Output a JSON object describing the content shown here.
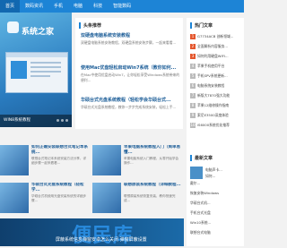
{
  "nav": {
    "items": [
      "首页",
      "数码资讯",
      "手机",
      "电脑",
      "科技",
      "智能数码"
    ]
  },
  "hero": {
    "logo_text": "系统之家",
    "caption": "WIN8系统教程"
  },
  "headlines": {
    "label": "头条推荐",
    "items": [
      {
        "title": "双硬盘电脑系统安装教程",
        "desc": "双硬盘电脑系统安装教程，双硬盘系统安装步骤，一起来看看..."
      },
      {
        "title": "使用Mac优盘轻松启动Win7系统（教你如何...",
        "desc": "在Mac中使用优盘启动Win7，让你轻松享受Windows系统带来的便利..."
      },
      {
        "title": "华硕台式光盘系统教程（轻松学会华硕台式...",
        "desc": "华硕台式光盘系统教程，教你一步步完成系统安装，轻松上手..."
      }
    ]
  },
  "hot": {
    "label": "热门文章",
    "rows": [
      {
        "num": "1",
        "text": "G7734ACB 创新领域..."
      },
      {
        "num": "2",
        "text": "全面解析内容服务..."
      },
      {
        "num": "3",
        "text": "如何利用硬盘WIFI..."
      },
      {
        "num": "4",
        "text": "苹果手机使用平台"
      },
      {
        "num": "5",
        "text": "手机SPV系统更新..."
      },
      {
        "num": "6",
        "text": "电脑系统安装教程"
      },
      {
        "num": "7",
        "text": "新版大T870强大功能"
      },
      {
        "num": "8",
        "text": "苹果12维修操作指南"
      },
      {
        "num": "9",
        "text": "索尼E3500深度体验"
      },
      {
        "num": "10",
        "text": "iS6000系统优化推荐"
      }
    ]
  },
  "cards": [
    {
      "title": "如何正确安装联想台式笔记本系统...",
      "desc": "联想台式笔记本系统安装方法分享，详细步骤一起来看看..."
    },
    {
      "title": "苹果电脑系统教程入门（简单易懂...",
      "desc": "苹果电脑系统入门教程，从零开始学会操作..."
    },
    {
      "title": "华硕台式光盘系统教程（轻松学...",
      "desc": "华硕台式机使用光盘安装系统的详细步骤..."
    },
    {
      "title": "联想原装系统教程（详细教程...",
      "desc": "联想原装系统恢复安装，教你快速完成..."
    }
  ],
  "side2": {
    "label": "最新文章",
    "rows": [
      "电脑声卡...",
      "如何...",
      "戴尔...",
      "恢复安装Windows",
      "华硕台式机...",
      "手机台式光盘",
      "Win10系统...",
      "联想台式电脑"
    ]
  },
  "banner": {
    "watermark": "便民库",
    "caption": "屏蔽系统信息弹窗安卓怎么关闭 弹窗屏蔽设置"
  }
}
